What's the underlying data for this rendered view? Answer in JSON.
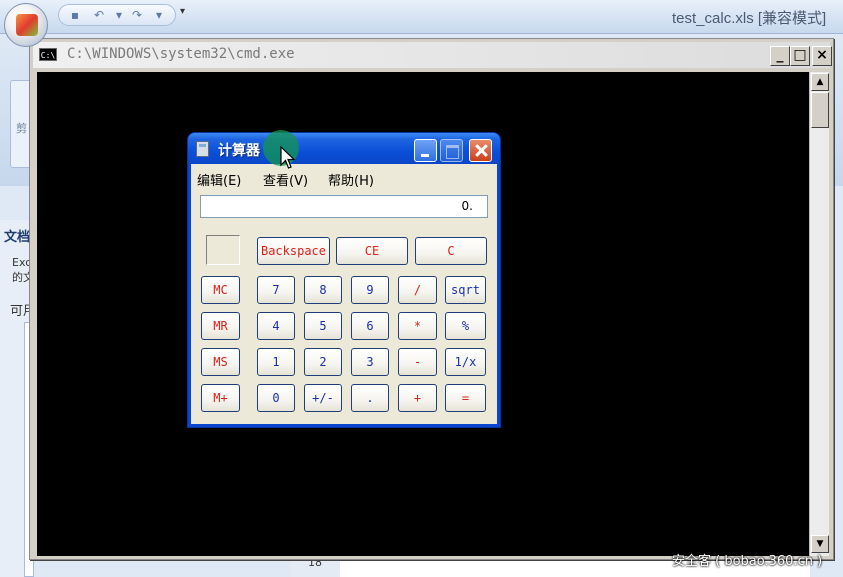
{
  "excel": {
    "title": "test_calc.xls  [兼容模式]",
    "ribbon_fragment": "剪",
    "pane_title": "文档",
    "pane_line1": "Exc",
    "pane_line1b": "的文",
    "pane_line2": "可用",
    "row_number": "18"
  },
  "cmd": {
    "title": "C:\\WINDOWS\\system32\\cmd.exe",
    "icon_text": "C:\\",
    "min_label": "_",
    "max_label": "□",
    "close_label": "×",
    "scroll_up": "▲",
    "scroll_down": "▼"
  },
  "calc": {
    "title": "计算器",
    "menu": {
      "edit": "编辑(E)",
      "view": "查看(V)",
      "help": "帮助(H)"
    },
    "display": "0.",
    "keys": {
      "backspace": "Backspace",
      "ce": "CE",
      "c": "C",
      "mc": "MC",
      "mr": "MR",
      "ms": "MS",
      "mplus": "M+",
      "k7": "7",
      "k8": "8",
      "k9": "9",
      "div": "/",
      "sqrt": "sqrt",
      "k4": "4",
      "k5": "5",
      "k6": "6",
      "mul": "*",
      "pct": "%",
      "k1": "1",
      "k2": "2",
      "k3": "3",
      "sub": "-",
      "inv": "1/x",
      "k0": "0",
      "neg": "+/-",
      "dot": ".",
      "add": "+",
      "eq": "="
    }
  },
  "watermark": "安全客 ( bobao.360.cn )",
  "colors": {
    "xp_blue": "#0a46d2",
    "calc_face": "#ece9d8",
    "key_red": "#e0201a",
    "key_blue": "#1a2fb0"
  }
}
